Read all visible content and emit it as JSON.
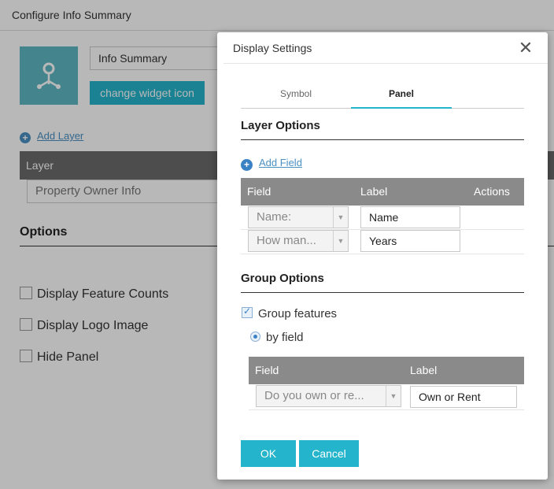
{
  "page": {
    "title": "Configure Info Summary",
    "widget_name": "Info Summary",
    "change_icon_label": "change widget icon",
    "add_layer_label": "Add Layer",
    "layer_table": {
      "header": "Layer",
      "rows": [
        "Property Owner Info"
      ]
    },
    "options_title": "Options",
    "checkboxes": [
      "Display Feature Counts",
      "Display Logo Image",
      "Hide Panel"
    ]
  },
  "dialog": {
    "title": "Display Settings",
    "close_icon": "close-icon",
    "tabs": [
      {
        "label": "Symbol",
        "active": false
      },
      {
        "label": "Panel",
        "active": true
      }
    ],
    "layer_options": {
      "title": "Layer Options",
      "add_field_label": "Add Field",
      "columns": {
        "field": "Field",
        "label": "Label",
        "actions": "Actions"
      },
      "rows": [
        {
          "field": "Name:",
          "label": "Name"
        },
        {
          "field": "How man...",
          "label": "Years"
        }
      ]
    },
    "group_options": {
      "title": "Group Options",
      "group_features_label": "Group features",
      "group_features_checked": true,
      "by_field_label": "by field",
      "by_field_selected": true,
      "columns": {
        "field": "Field",
        "label": "Label"
      },
      "rows": [
        {
          "field": "Do you own or re...",
          "label": "Own or Rent"
        }
      ]
    },
    "buttons": {
      "ok": "OK",
      "cancel": "Cancel"
    }
  },
  "colors": {
    "accent": "#24b5cc",
    "link": "#4a90c2",
    "overlay": "rgba(0,0,0,0.28)"
  }
}
